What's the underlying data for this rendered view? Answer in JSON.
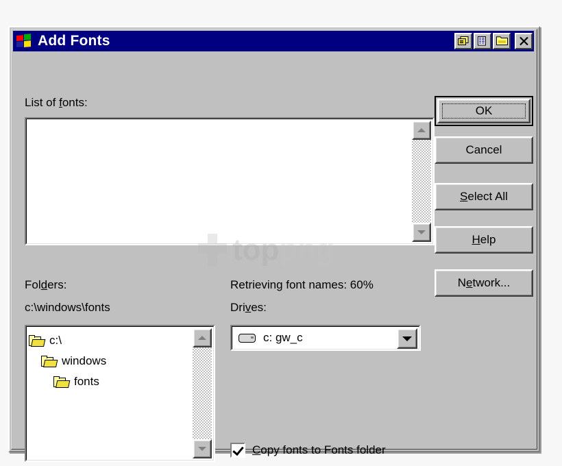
{
  "window": {
    "title": "Add Fonts",
    "icon": "windows-flag-icon",
    "titlebar_color": "#000080",
    "face_color": "#c0c0c0",
    "buttons": [
      {
        "name": "list-view-button",
        "glyph": "list-view-icon"
      },
      {
        "name": "details-view-button",
        "glyph": "details-view-icon"
      },
      {
        "name": "up-one-level-button",
        "glyph": "folder-up-icon"
      },
      {
        "name": "close-button",
        "glyph": "close-x-icon"
      }
    ]
  },
  "fonts_list": {
    "label_before": "List of ",
    "label_accel": "f",
    "label_after": "onts:",
    "items": [],
    "scrollbar": {
      "up": "scroll-up-arrow",
      "down": "scroll-down-arrow"
    }
  },
  "folders": {
    "label_before": "Fol",
    "label_accel": "d",
    "label_after": "ers:",
    "current_path": "c:\\windows\\fonts",
    "tree": [
      {
        "label": "c:\\",
        "depth": 0,
        "icon": "open-folder-icon"
      },
      {
        "label": "windows",
        "depth": 1,
        "icon": "open-folder-icon"
      },
      {
        "label": "fonts",
        "depth": 2,
        "icon": "open-folder-icon"
      }
    ]
  },
  "status": {
    "text": "Retrieving font names: 60%",
    "progress_percent": 60
  },
  "drives": {
    "label_before": "Dri",
    "label_accel": "v",
    "label_after": "es:",
    "selected": "c: gw_c",
    "icon": "hard-drive-icon",
    "options": [
      "c: gw_c"
    ]
  },
  "copy_option": {
    "checked": true,
    "label_before": "",
    "label_accel": "C",
    "label_after": "opy fonts to Fonts folder"
  },
  "actions": [
    {
      "name": "ok-button",
      "before": "",
      "accel": "",
      "after": "OK",
      "default": true,
      "focused": true
    },
    {
      "name": "cancel-button",
      "before": "Cancel",
      "accel": "",
      "after": "",
      "default": false,
      "focused": false
    },
    {
      "name": "select-all-button",
      "before": "",
      "accel": "S",
      "after": "elect All",
      "default": false,
      "focused": false
    },
    {
      "name": "help-button",
      "before": "",
      "accel": "H",
      "after": "elp",
      "default": false,
      "focused": false
    },
    {
      "name": "network-button",
      "before": "N",
      "accel": "e",
      "after": "twork...",
      "default": false,
      "focused": false
    }
  ],
  "watermark": {
    "text_top": "top",
    "text_png": "png"
  }
}
